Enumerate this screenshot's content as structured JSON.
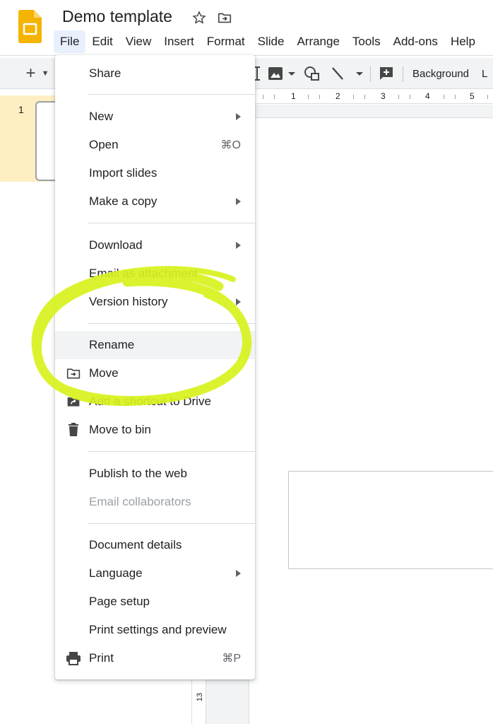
{
  "app": {
    "doc_title": "Demo template",
    "menubar": [
      "File",
      "Edit",
      "View",
      "Insert",
      "Format",
      "Slide",
      "Arrange",
      "Tools",
      "Add-ons",
      "Help"
    ],
    "active_menu": "File"
  },
  "toolbar": {
    "background_label": "Background",
    "layout_label": "L"
  },
  "filmstrip": {
    "slide_number": "1"
  },
  "ruler": {
    "numbers": [
      "1",
      "2",
      "3",
      "4",
      "5"
    ],
    "vertical_number": "13"
  },
  "file_menu": {
    "items": [
      {
        "label": "Share"
      },
      {
        "label": "New",
        "submenu": true
      },
      {
        "label": "Open",
        "shortcut": "⌘O"
      },
      {
        "label": "Import slides"
      },
      {
        "label": "Make a copy",
        "submenu": true
      },
      {
        "label": "Download",
        "submenu": true
      },
      {
        "label": "Email as attachment"
      },
      {
        "label": "Version history",
        "submenu": true
      },
      {
        "label": "Rename",
        "hovered": true
      },
      {
        "label": "Move",
        "icon": "move-folder-icon"
      },
      {
        "label": "Add a shortcut to Drive",
        "icon": "drive-shortcut-icon"
      },
      {
        "label": "Move to bin",
        "icon": "trash-icon"
      },
      {
        "label": "Publish to the web"
      },
      {
        "label": "Email collaborators",
        "disabled": true
      },
      {
        "label": "Document details"
      },
      {
        "label": "Language",
        "submenu": true
      },
      {
        "label": "Page setup"
      },
      {
        "label": "Print settings and preview"
      },
      {
        "label": "Print",
        "shortcut": "⌘P",
        "icon": "printer-icon"
      }
    ]
  },
  "colors": {
    "highlighter": "#d8f21e",
    "logo_yellow": "#f4b400",
    "active_menu_bg": "#e8f0fe",
    "selected_slide_bg": "#feefc3"
  }
}
